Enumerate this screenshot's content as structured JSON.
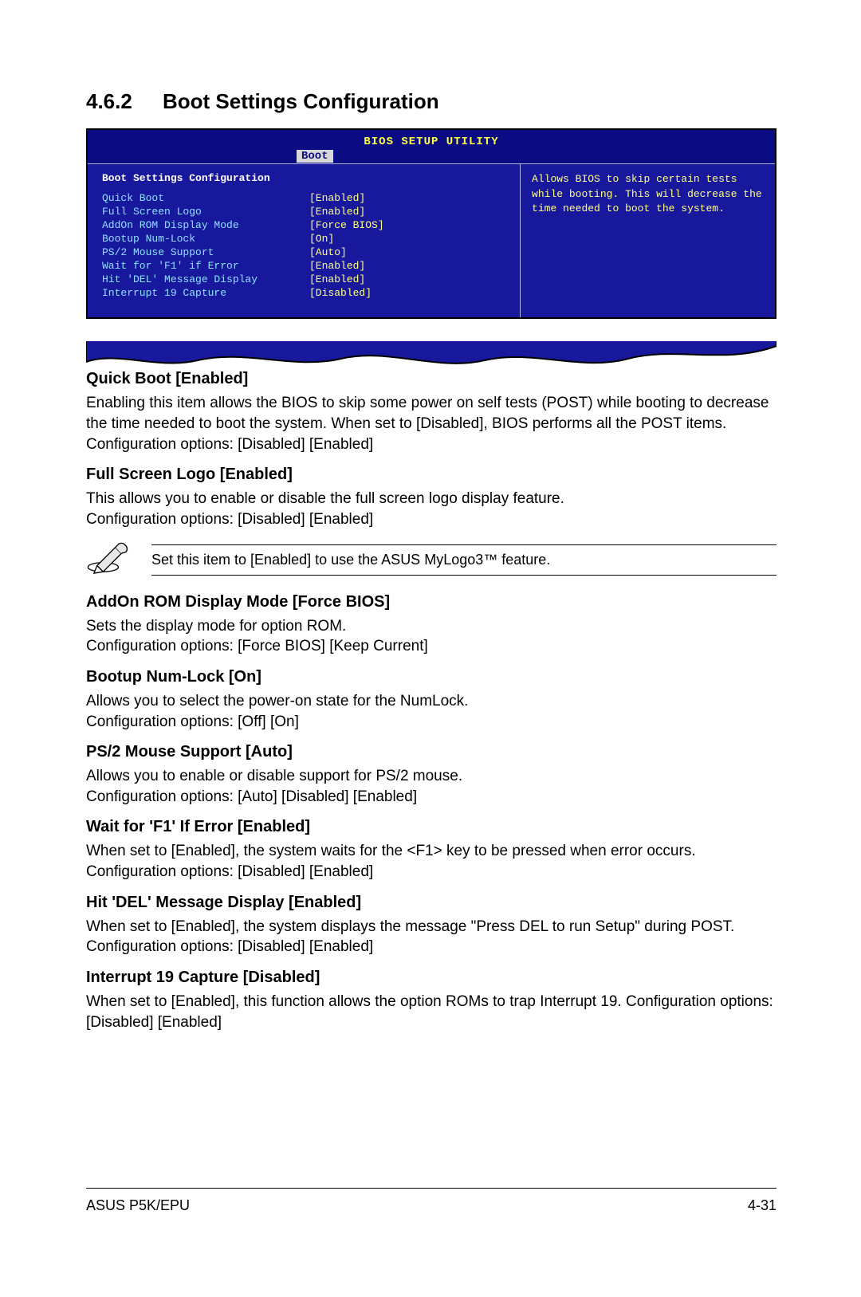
{
  "heading": {
    "number": "4.6.2",
    "title": "Boot Settings Configuration"
  },
  "bios": {
    "utility_title": "BIOS SETUP UTILITY",
    "menu_selected": "Boot",
    "panel_title": "Boot Settings Configuration",
    "rows": [
      {
        "label": "Quick Boot",
        "value": "[Enabled]"
      },
      {
        "label": "Full Screen Logo",
        "value": "[Enabled]"
      },
      {
        "label": "AddOn ROM Display Mode",
        "value": "[Force BIOS]"
      },
      {
        "label": "Bootup Num-Lock",
        "value": "[On]"
      },
      {
        "label": "PS/2 Mouse Support",
        "value": "[Auto]"
      },
      {
        "label": "Wait for 'F1' if Error",
        "value": "[Enabled]"
      },
      {
        "label": "Hit 'DEL' Message Display",
        "value": "[Enabled]"
      },
      {
        "label": "Interrupt 19 Capture",
        "value": "[Disabled]"
      }
    ],
    "help_text": "Allows BIOS to skip certain tests while booting. This will decrease the time needed to boot the system."
  },
  "settings": [
    {
      "title": "Quick Boot [Enabled]",
      "body": "Enabling this item allows the BIOS to skip some power on self tests (POST) while booting to decrease the time needed to boot the system. When set to [Disabled], BIOS performs all the POST items. Configuration options: [Disabled] [Enabled]"
    },
    {
      "title": "Full Screen Logo [Enabled]",
      "body": "This allows you to enable or disable the full screen logo display feature.\nConfiguration options: [Disabled] [Enabled]"
    }
  ],
  "note": {
    "text": "Set this item to [Enabled] to use the ASUS MyLogo3™ feature."
  },
  "settings2": [
    {
      "title": "AddOn ROM Display Mode [Force BIOS]",
      "body": "Sets the display mode for option ROM.\nConfiguration options: [Force BIOS] [Keep Current]"
    },
    {
      "title": "Bootup Num-Lock [On]",
      "body": "Allows you to select the power-on state for the NumLock.\nConfiguration options: [Off] [On]"
    },
    {
      "title": "PS/2 Mouse Support [Auto]",
      "body": "Allows you to enable or disable support for PS/2 mouse.\nConfiguration options: [Auto] [Disabled] [Enabled]"
    },
    {
      "title": "Wait for 'F1' If Error [Enabled]",
      "body": "When set to [Enabled], the system waits for the <F1> key to be pressed when error occurs. Configuration options: [Disabled] [Enabled]"
    },
    {
      "title": "Hit 'DEL' Message Display [Enabled]",
      "body": "When set to [Enabled], the system displays the message \"Press DEL to run Setup\" during POST. Configuration options: [Disabled] [Enabled]"
    },
    {
      "title": "Interrupt 19 Capture [Disabled]",
      "body": "When set to [Enabled], this function allows the option ROMs to trap Interrupt 19. Configuration options: [Disabled] [Enabled]"
    }
  ],
  "footer": {
    "left": "ASUS P5K/EPU",
    "right": "4-31"
  }
}
